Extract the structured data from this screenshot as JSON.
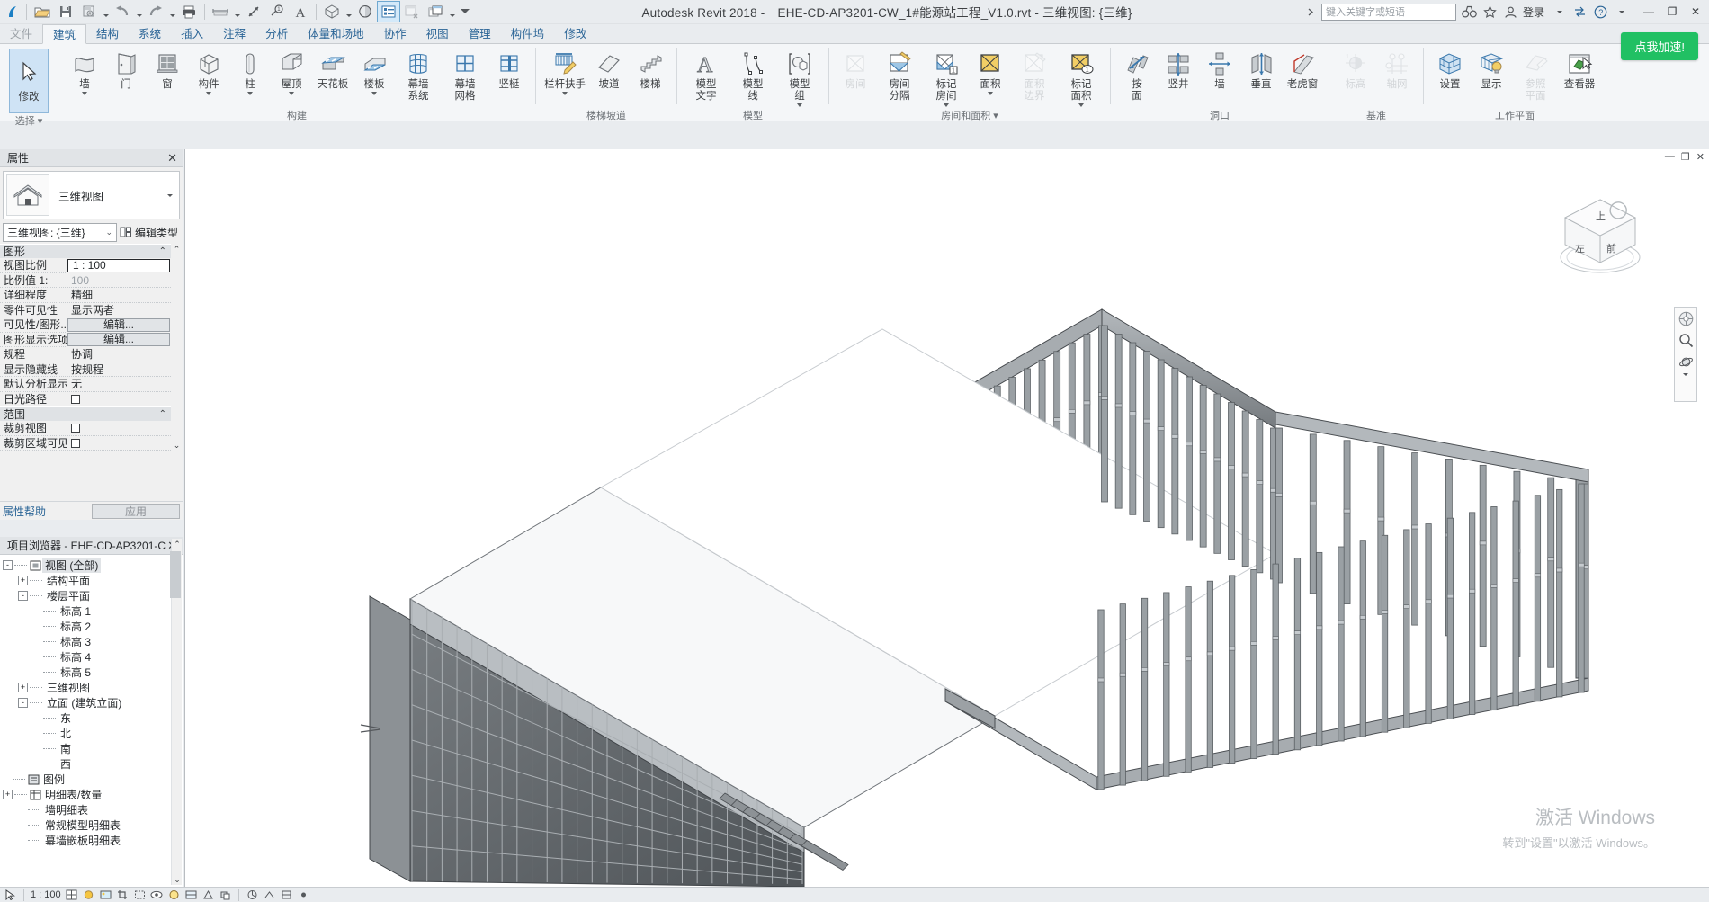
{
  "window": {
    "app_title": "Autodesk Revit 2018 -",
    "file_title": "EHE-CD-AP3201-CW_1#能源站工程_V1.0.rvt - 三维视图: {三维}",
    "minimize": "—",
    "restore": "❐",
    "close": "✕"
  },
  "quick_access": {
    "items": [
      {
        "name": "open-icon",
        "glyph": "open"
      },
      {
        "name": "save-icon",
        "glyph": "save"
      },
      {
        "name": "save-as-icon",
        "glyph": "saveas",
        "dropdown": true
      },
      {
        "name": "undo-icon",
        "glyph": "undo",
        "dropdown": true
      },
      {
        "name": "redo-icon",
        "glyph": "redo",
        "dropdown": true
      },
      {
        "name": "print-icon",
        "glyph": "print"
      },
      {
        "name": "measure-icon",
        "glyph": "measure",
        "dropdown": true
      },
      {
        "name": "aligned-dimension-icon",
        "glyph": "dim"
      },
      {
        "name": "tag-icon",
        "glyph": "tag"
      },
      {
        "name": "text-icon",
        "glyph": "text"
      },
      {
        "name": "default-3d-view-icon",
        "glyph": "cube3d",
        "dropdown": true
      },
      {
        "name": "section-icon",
        "glyph": "section"
      },
      {
        "name": "thin-lines-icon",
        "glyph": "thinlines",
        "selected": true
      },
      {
        "name": "close-hidden-windows-icon",
        "glyph": "closehidden",
        "disabled": true
      },
      {
        "name": "switch-windows-icon",
        "glyph": "switchwin",
        "dropdown": true
      },
      {
        "name": "customize-qat-icon",
        "glyph": "customize"
      }
    ]
  },
  "titlebar_right": {
    "search_placeholder": "键入关键字或短语",
    "help_icon": "help-icon",
    "signin_label": "登录",
    "icons": [
      "binoculars-icon",
      "star-icon",
      "user-icon",
      "exchange-icon",
      "help-icon"
    ]
  },
  "ribbon": {
    "tabs": [
      {
        "label": "文件",
        "state": "dim"
      },
      {
        "label": "建筑",
        "state": "active"
      },
      {
        "label": "结构",
        "state": "normal"
      },
      {
        "label": "系统",
        "state": "normal"
      },
      {
        "label": "插入",
        "state": "normal"
      },
      {
        "label": "注释",
        "state": "normal"
      },
      {
        "label": "分析",
        "state": "normal"
      },
      {
        "label": "体量和场地",
        "state": "normal"
      },
      {
        "label": "协作",
        "state": "normal"
      },
      {
        "label": "视图",
        "state": "normal"
      },
      {
        "label": "管理",
        "state": "normal"
      },
      {
        "label": "构件坞",
        "state": "normal"
      },
      {
        "label": "修改",
        "state": "normal"
      }
    ],
    "accelerate_button": "点我加速!",
    "panels": [
      {
        "name": "select",
        "title": "选择 ▾",
        "commands": [
          {
            "label": "修改",
            "icon": "cursor-arrow-icon",
            "style": "modify"
          }
        ]
      },
      {
        "name": "build",
        "title": "构建",
        "commands": [
          {
            "label": "墙",
            "icon": "wall-icon",
            "dropdown": true
          },
          {
            "label": "门",
            "icon": "door-icon"
          },
          {
            "label": "窗",
            "icon": "window-icon"
          },
          {
            "label": "构件",
            "icon": "component-icon",
            "dropdown": true
          },
          {
            "label": "柱",
            "icon": "column-icon",
            "dropdown": true
          },
          {
            "label": "屋顶",
            "icon": "roof-icon",
            "dropdown": true
          },
          {
            "label": "天花板",
            "icon": "ceiling-icon"
          },
          {
            "label": "楼板",
            "icon": "floor-icon",
            "dropdown": true
          },
          {
            "label": "幕墙\n系统",
            "icon": "curtain-system-icon"
          },
          {
            "label": "幕墙\n网格",
            "icon": "curtain-grid-icon"
          },
          {
            "label": "竖梃",
            "icon": "mullion-icon"
          }
        ]
      },
      {
        "name": "circulation",
        "title": "楼梯坡道",
        "commands": [
          {
            "label": "栏杆扶手",
            "icon": "railing-icon",
            "dropdown": true
          },
          {
            "label": "坡道",
            "icon": "ramp-icon"
          },
          {
            "label": "楼梯",
            "icon": "stair-icon"
          }
        ]
      },
      {
        "name": "model",
        "title": "模型",
        "commands": [
          {
            "label": "模型\n文字",
            "icon": "model-text-icon"
          },
          {
            "label": "模型\n线",
            "icon": "model-line-icon"
          },
          {
            "label": "模型\n组",
            "icon": "model-group-icon",
            "dropdown": true
          }
        ]
      },
      {
        "name": "room-area",
        "title": "房间和面积 ▾",
        "commands": [
          {
            "label": "房间",
            "icon": "room-icon",
            "disabled": true
          },
          {
            "label": "房间\n分隔",
            "icon": "room-separator-icon"
          },
          {
            "label": "标记\n房间",
            "icon": "tag-room-icon",
            "dropdown": true
          },
          {
            "label": "面积",
            "icon": "area-icon",
            "dropdown": true
          },
          {
            "label": "面积\n边界",
            "icon": "area-boundary-icon",
            "disabled": true
          },
          {
            "label": "标记\n面积",
            "icon": "tag-area-icon",
            "dropdown": true
          }
        ]
      },
      {
        "name": "opening",
        "title": "洞口",
        "commands": [
          {
            "label": "按\n面",
            "icon": "by-face-icon"
          },
          {
            "label": "竖井",
            "icon": "shaft-icon"
          },
          {
            "label": "墙",
            "icon": "wall-opening-icon"
          },
          {
            "label": "垂直",
            "icon": "vertical-opening-icon"
          },
          {
            "label": "老虎窗",
            "icon": "dormer-opening-icon"
          }
        ]
      },
      {
        "name": "datum",
        "title": "基准",
        "commands": [
          {
            "label": "标高",
            "icon": "level-icon",
            "disabled": true
          },
          {
            "label": "轴网",
            "icon": "grid-icon",
            "disabled": true
          }
        ]
      },
      {
        "name": "work-plane",
        "title": "工作平面",
        "commands": [
          {
            "label": "设置",
            "icon": "set-workplane-icon"
          },
          {
            "label": "显示",
            "icon": "show-workplane-icon"
          },
          {
            "label": "参照\n平面",
            "icon": "reference-plane-icon",
            "disabled": true
          },
          {
            "label": "查看器",
            "icon": "viewer-icon"
          }
        ]
      }
    ]
  },
  "properties": {
    "panel_title": "属性",
    "close": "✕",
    "type_name": "三维视图",
    "type_icon": "house-icon",
    "selector_value": "三维视图: {三维}",
    "edit_type_label": "编辑类型",
    "edit_type_icon": "edit-type-icon",
    "groups": [
      {
        "label": "图形",
        "rows": [
          {
            "key": "视图比例",
            "value": "1 : 100",
            "kind": "boxed"
          },
          {
            "key": "比例值    1:",
            "value": "100",
            "kind": "gray"
          },
          {
            "key": "详细程度",
            "value": "精细",
            "kind": "text"
          },
          {
            "key": "零件可见性",
            "value": "显示两者",
            "kind": "text"
          },
          {
            "key": "可见性/图形...",
            "value": "编辑...",
            "kind": "button"
          },
          {
            "key": "图形显示选项",
            "value": "编辑...",
            "kind": "button"
          },
          {
            "key": "规程",
            "value": "协调",
            "kind": "text"
          },
          {
            "key": "显示隐藏线",
            "value": "按规程",
            "kind": "text"
          },
          {
            "key": "默认分析显示...",
            "value": "无",
            "kind": "text"
          },
          {
            "key": "日光路径",
            "value": "",
            "kind": "checkbox"
          }
        ]
      },
      {
        "label": "范围",
        "rows": [
          {
            "key": "裁剪视图",
            "value": "",
            "kind": "checkbox"
          },
          {
            "key": "裁剪区域可见",
            "value": "",
            "kind": "checkbox"
          }
        ]
      }
    ],
    "help_link": "属性帮助",
    "apply_label": "应用"
  },
  "project_browser": {
    "panel_title": "项目浏览器 - EHE-CD-AP3201-CW_...",
    "close": "✕",
    "tree": [
      {
        "label": "视图 (全部)",
        "depth": 0,
        "expander": "-",
        "icon": "views-icon",
        "selected": true
      },
      {
        "label": "结构平面",
        "depth": 1,
        "expander": "+"
      },
      {
        "label": "楼层平面",
        "depth": 1,
        "expander": "-"
      },
      {
        "label": "标高 1",
        "depth": 2,
        "expander": ""
      },
      {
        "label": "标高 2",
        "depth": 2,
        "expander": ""
      },
      {
        "label": "标高 3",
        "depth": 2,
        "expander": ""
      },
      {
        "label": "标高 4",
        "depth": 2,
        "expander": ""
      },
      {
        "label": "标高 5",
        "depth": 2,
        "expander": ""
      },
      {
        "label": "三维视图",
        "depth": 1,
        "expander": "+"
      },
      {
        "label": "立面 (建筑立面)",
        "depth": 1,
        "expander": "-"
      },
      {
        "label": "东",
        "depth": 2,
        "expander": ""
      },
      {
        "label": "北",
        "depth": 2,
        "expander": ""
      },
      {
        "label": "南",
        "depth": 2,
        "expander": ""
      },
      {
        "label": "西",
        "depth": 2,
        "expander": ""
      },
      {
        "label": "图例",
        "depth": 0,
        "expander": "",
        "icon": "legend-icon"
      },
      {
        "label": "明细表/数量",
        "depth": 0,
        "expander": "+",
        "icon": "schedule-icon"
      },
      {
        "label": "墙明细表",
        "depth": 1,
        "expander": ""
      },
      {
        "label": "常规模型明细表",
        "depth": 1,
        "expander": ""
      },
      {
        "label": "幕墙嵌板明细表",
        "depth": 1,
        "expander": ""
      }
    ]
  },
  "canvas": {
    "view_label": "三维视图: {三维}",
    "win_minimize": "—",
    "win_restore": "❐",
    "win_close": "✕",
    "viewcube": {
      "top": "上",
      "front": "前",
      "left": "左"
    },
    "nav_bar_icons": [
      "steering-wheel-icon",
      "pan-icon",
      "zoom-icon",
      "orbit-icon",
      "look-icon"
    ],
    "watermark_line1": "激活 Windows",
    "watermark_line2": "转到\"设置\"以激活 Windows。"
  },
  "status_bar": {
    "scale_label": "1 : 100",
    "items": [
      "model-graphics-style-icon",
      "shadows-icon",
      "render-icon",
      "crop-icon",
      "hide-crop-icon",
      "temporary-hide-icon",
      "reveal-hidden-icon",
      "temporary-view-icon",
      "analytical-model-icon",
      "highlight-displacement-icon"
    ]
  }
}
